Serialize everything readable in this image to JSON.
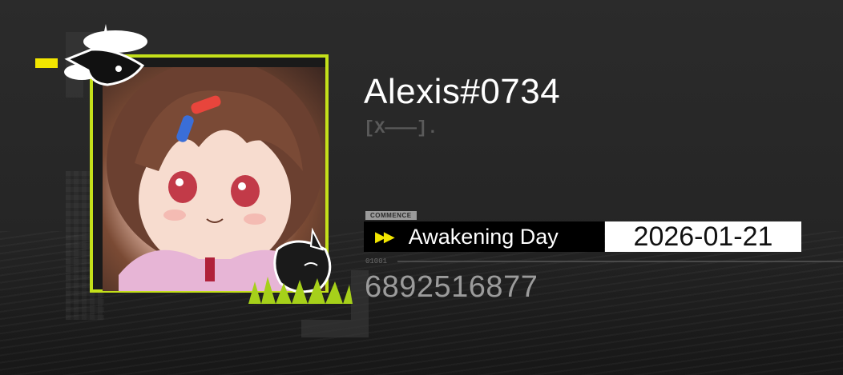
{
  "profile": {
    "username": "Alexis#0734",
    "tag_placeholder": "[X———].",
    "commence_label": "COMMENCE",
    "awakening_label": "Awakening Day",
    "awakening_date": "2026-01-21",
    "code_label": "01001",
    "uid": "6892516877"
  },
  "icons": {
    "arrows": "▶▶",
    "avatar": "avatar-portrait",
    "bird_top": "bird-cloud-icon",
    "bird_bottom": "bird-grass-icon"
  },
  "colors": {
    "accent_lime": "#c4e01a",
    "accent_yellow": "#f2e600",
    "background": "#2b2b2b"
  }
}
